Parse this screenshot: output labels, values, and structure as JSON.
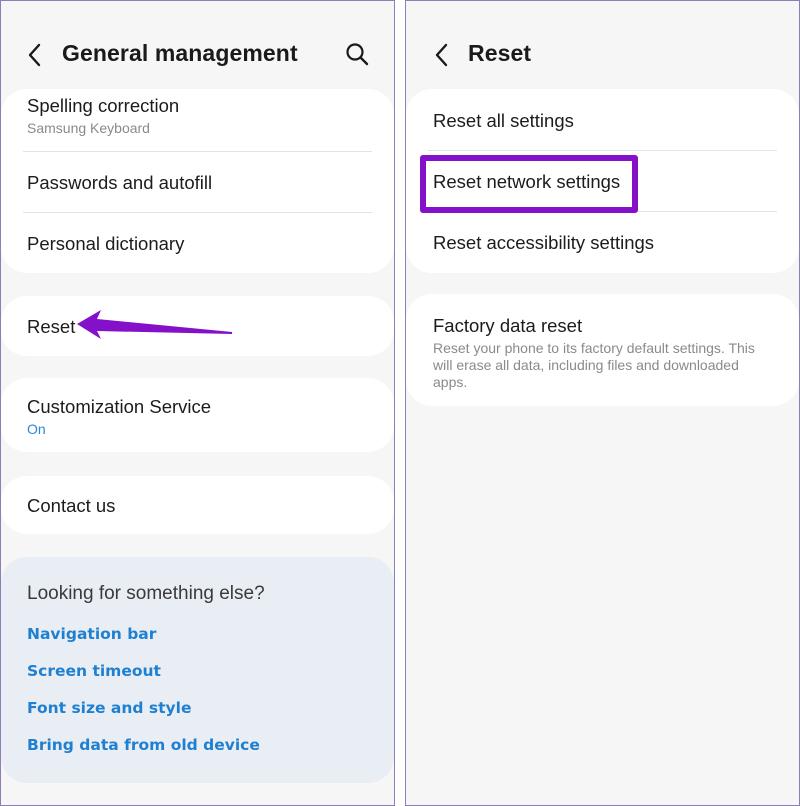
{
  "left": {
    "title": "General management",
    "items": [
      {
        "title": "Spelling correction",
        "sub": "Samsung Keyboard"
      },
      {
        "title": "Passwords and autofill"
      },
      {
        "title": "Personal dictionary"
      },
      {
        "title": "Reset"
      },
      {
        "title": "Customization Service",
        "sub": "On"
      },
      {
        "title": "Contact us"
      }
    ],
    "suggestions": {
      "title": "Looking for something else?",
      "links": [
        "Navigation bar",
        "Screen timeout",
        "Font size and style",
        "Bring data from old device"
      ]
    }
  },
  "right": {
    "title": "Reset",
    "items": [
      {
        "title": "Reset all settings"
      },
      {
        "title": "Reset network settings"
      },
      {
        "title": "Reset accessibility settings"
      },
      {
        "title": "Factory data reset",
        "sub": "Reset your phone to its factory default settings. This will erase all data, including files and downloaded apps."
      }
    ]
  },
  "colors": {
    "annotation_purple": "#8410c9",
    "link_blue": "#1f7fd1",
    "background": "#f6f6f6"
  },
  "icons": [
    "back-icon",
    "search-icon",
    "annotation-arrow"
  ]
}
